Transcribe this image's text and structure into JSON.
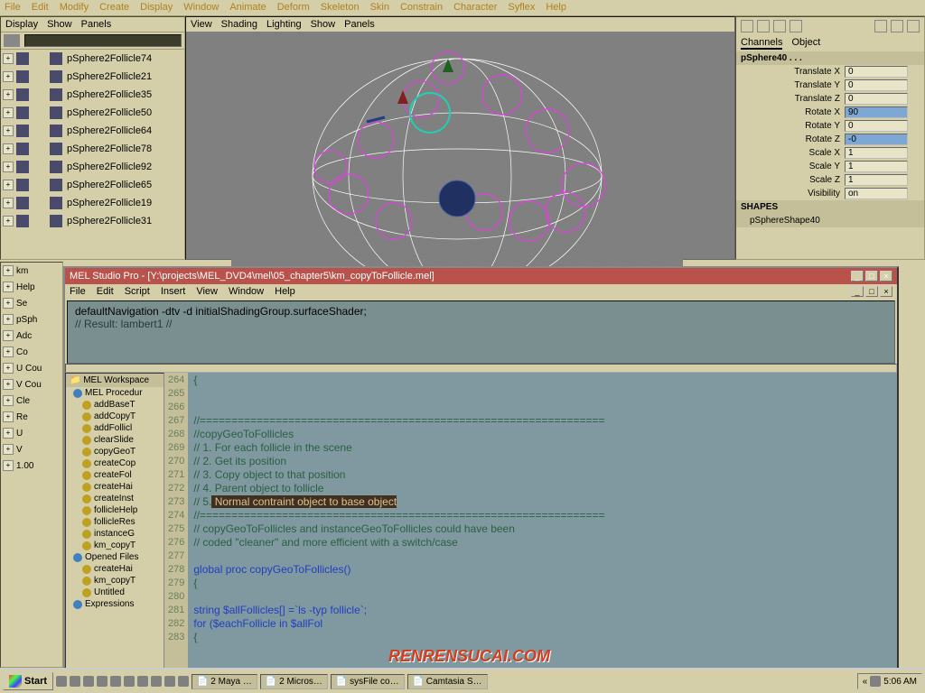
{
  "main_menu": [
    "File",
    "Edit",
    "Modify",
    "Create",
    "Display",
    "Window",
    "Animate",
    "Deform",
    "Skeleton",
    "Skin",
    "Constrain",
    "Character",
    "Syflex",
    "Help"
  ],
  "outliner": {
    "menus": [
      "Display",
      "Show",
      "Panels"
    ],
    "items": [
      "pSphere2Follicle74",
      "pSphere2Follicle21",
      "pSphere2Follicle35",
      "pSphere2Follicle50",
      "pSphere2Follicle64",
      "pSphere2Follicle78",
      "pSphere2Follicle92",
      "pSphere2Follicle65",
      "pSphere2Follicle19",
      "pSphere2Follicle31"
    ]
  },
  "viewport_menus": [
    "View",
    "Shading",
    "Lighting",
    "Show",
    "Panels"
  ],
  "channels": {
    "tabs": [
      "Channels",
      "Object"
    ],
    "object": "pSphere40 . . .",
    "attrs": [
      {
        "name": "Translate X",
        "val": "0"
      },
      {
        "name": "Translate Y",
        "val": "0"
      },
      {
        "name": "Translate Z",
        "val": "0"
      },
      {
        "name": "Rotate X",
        "val": "90",
        "hl": true
      },
      {
        "name": "Rotate Y",
        "val": "0"
      },
      {
        "name": "Rotate Z",
        "val": "-0",
        "hl": true
      },
      {
        "name": "Scale X",
        "val": "1"
      },
      {
        "name": "Scale Y",
        "val": "1"
      },
      {
        "name": "Scale Z",
        "val": "1"
      },
      {
        "name": "Visibility",
        "val": "on"
      }
    ],
    "shapes_header": "SHAPES",
    "shape": "pSphereShape40"
  },
  "mel": {
    "title": "MEL Studio Pro - [Y:\\projects\\MEL_DVD4\\mel\\05_chapter5\\km_copyToFollicle.mel]",
    "menus": [
      "File",
      "Edit",
      "Script",
      "Insert",
      "View",
      "Window",
      "Help"
    ],
    "result_l1": "defaultNavigation -dtv -d initialShadingGroup.surfaceShader;",
    "result_l2": "// Result: lambert1 //",
    "tree_header": "MEL Workspace",
    "tree_folder": "MEL Procedur",
    "tree_procs": [
      "addBaseT",
      "addCopyT",
      "addFollicl",
      "clearSlide",
      "copyGeoT",
      "createCop",
      "createFol",
      "createHai",
      "createInst",
      "follicleHelp",
      "follicleRes",
      "instanceG",
      "km_copyT"
    ],
    "tree_opened": "Opened Files",
    "tree_files": [
      "createHai",
      "km_copyT",
      "Untitled"
    ],
    "tree_expr": "Expressions",
    "lines": [
      {
        "n": 264,
        "t": "{"
      },
      {
        "n": 265,
        "t": ""
      },
      {
        "n": 266,
        "t": ""
      },
      {
        "n": 267,
        "t": "//================================================================"
      },
      {
        "n": 268,
        "t": "//copyGeoToFollicles"
      },
      {
        "n": 269,
        "t": "// 1. For each follicle in the scene"
      },
      {
        "n": 270,
        "t": "// 2. Get its position"
      },
      {
        "n": 271,
        "t": "// 3. Copy object to that position"
      },
      {
        "n": 272,
        "t": "// 4. Parent object to follicle"
      },
      {
        "n": 273,
        "t": "// 5.",
        "hl": " Normal contraint object to base object"
      },
      {
        "n": 274,
        "t": "//================================================================"
      },
      {
        "n": 275,
        "t": "// copyGeoToFollicles and instanceGeoToFollicles could have been"
      },
      {
        "n": 276,
        "t": "// coded \"cleaner\" and more efficient with a switch/case"
      },
      {
        "n": 277,
        "t": ""
      },
      {
        "n": 278,
        "t": "global proc copyGeoToFollicles()",
        "kw": true
      },
      {
        "n": 279,
        "t": "{"
      },
      {
        "n": 280,
        "t": ""
      },
      {
        "n": 281,
        "t": "string $allFollicles[] =`ls -typ follicle`;",
        "kw": true
      },
      {
        "n": 282,
        "t": "for ($eachFollicle in $allFol",
        "kw": true
      },
      {
        "n": 283,
        "t": "{"
      }
    ]
  },
  "left_items": [
    "km",
    "Help",
    "Se",
    "pSph",
    "Adc",
    "Co",
    "U Cou",
    "V Cou",
    "Cle",
    "Re",
    "U",
    "V",
    "1.00"
  ],
  "taskbar": {
    "start": "Start",
    "items": [
      "2 Maya …",
      "2 Micros…",
      "sysFile co…",
      "Camtasia S…"
    ],
    "tray_arrow": "«",
    "time": "5:06 AM"
  },
  "watermark": "RENRENSUCAI.COM"
}
